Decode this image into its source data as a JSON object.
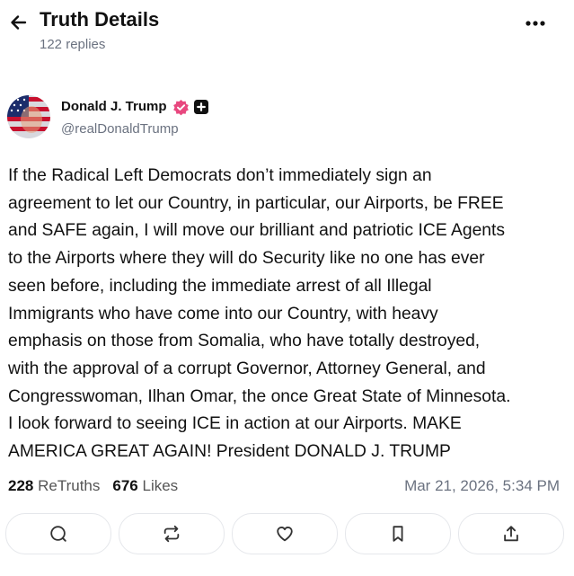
{
  "header": {
    "title": "Truth Details",
    "replies": "122 replies",
    "back_icon": "arrow-left-icon",
    "more_icon": "more-dots-icon"
  },
  "post": {
    "author": {
      "name": "Donald J. Trump",
      "handle": "@realDonaldTrump",
      "verified_color": "#e8487f"
    },
    "text": "If the Radical Left Democrats don’t immediately sign an\nagreement to let our Country, in particular, our Airports, be FREE\nand SAFE again, I will move our brilliant and patriotic ICE Agents\nto the Airports where they will do Security like no one has ever\nseen before, including the immediate arrest of all Illegal\nImmigrants who have come into our Country, with heavy\nemphasis on those from Somalia, who have totally destroyed,\nwith the approval of a corrupt Governor, Attorney General, and\nCongresswoman, Ilhan Omar, the once Great State of Minnesota.\nI look forward to seeing ICE in action at our Airports. MAKE\nAMERICA GREAT AGAIN! President DONALD J. TRUMP",
    "retruths_count": "228",
    "retruths_label": "ReTruths",
    "likes_count": "676",
    "likes_label": "Likes",
    "timestamp": "Mar 21, 2026, 5:34 PM"
  },
  "actions": [
    {
      "name": "reply-button",
      "icon": "comment-icon"
    },
    {
      "name": "retruth-button",
      "icon": "repost-icon"
    },
    {
      "name": "like-button",
      "icon": "heart-icon"
    },
    {
      "name": "bookmark-button",
      "icon": "bookmark-icon"
    },
    {
      "name": "share-button",
      "icon": "share-icon"
    }
  ]
}
